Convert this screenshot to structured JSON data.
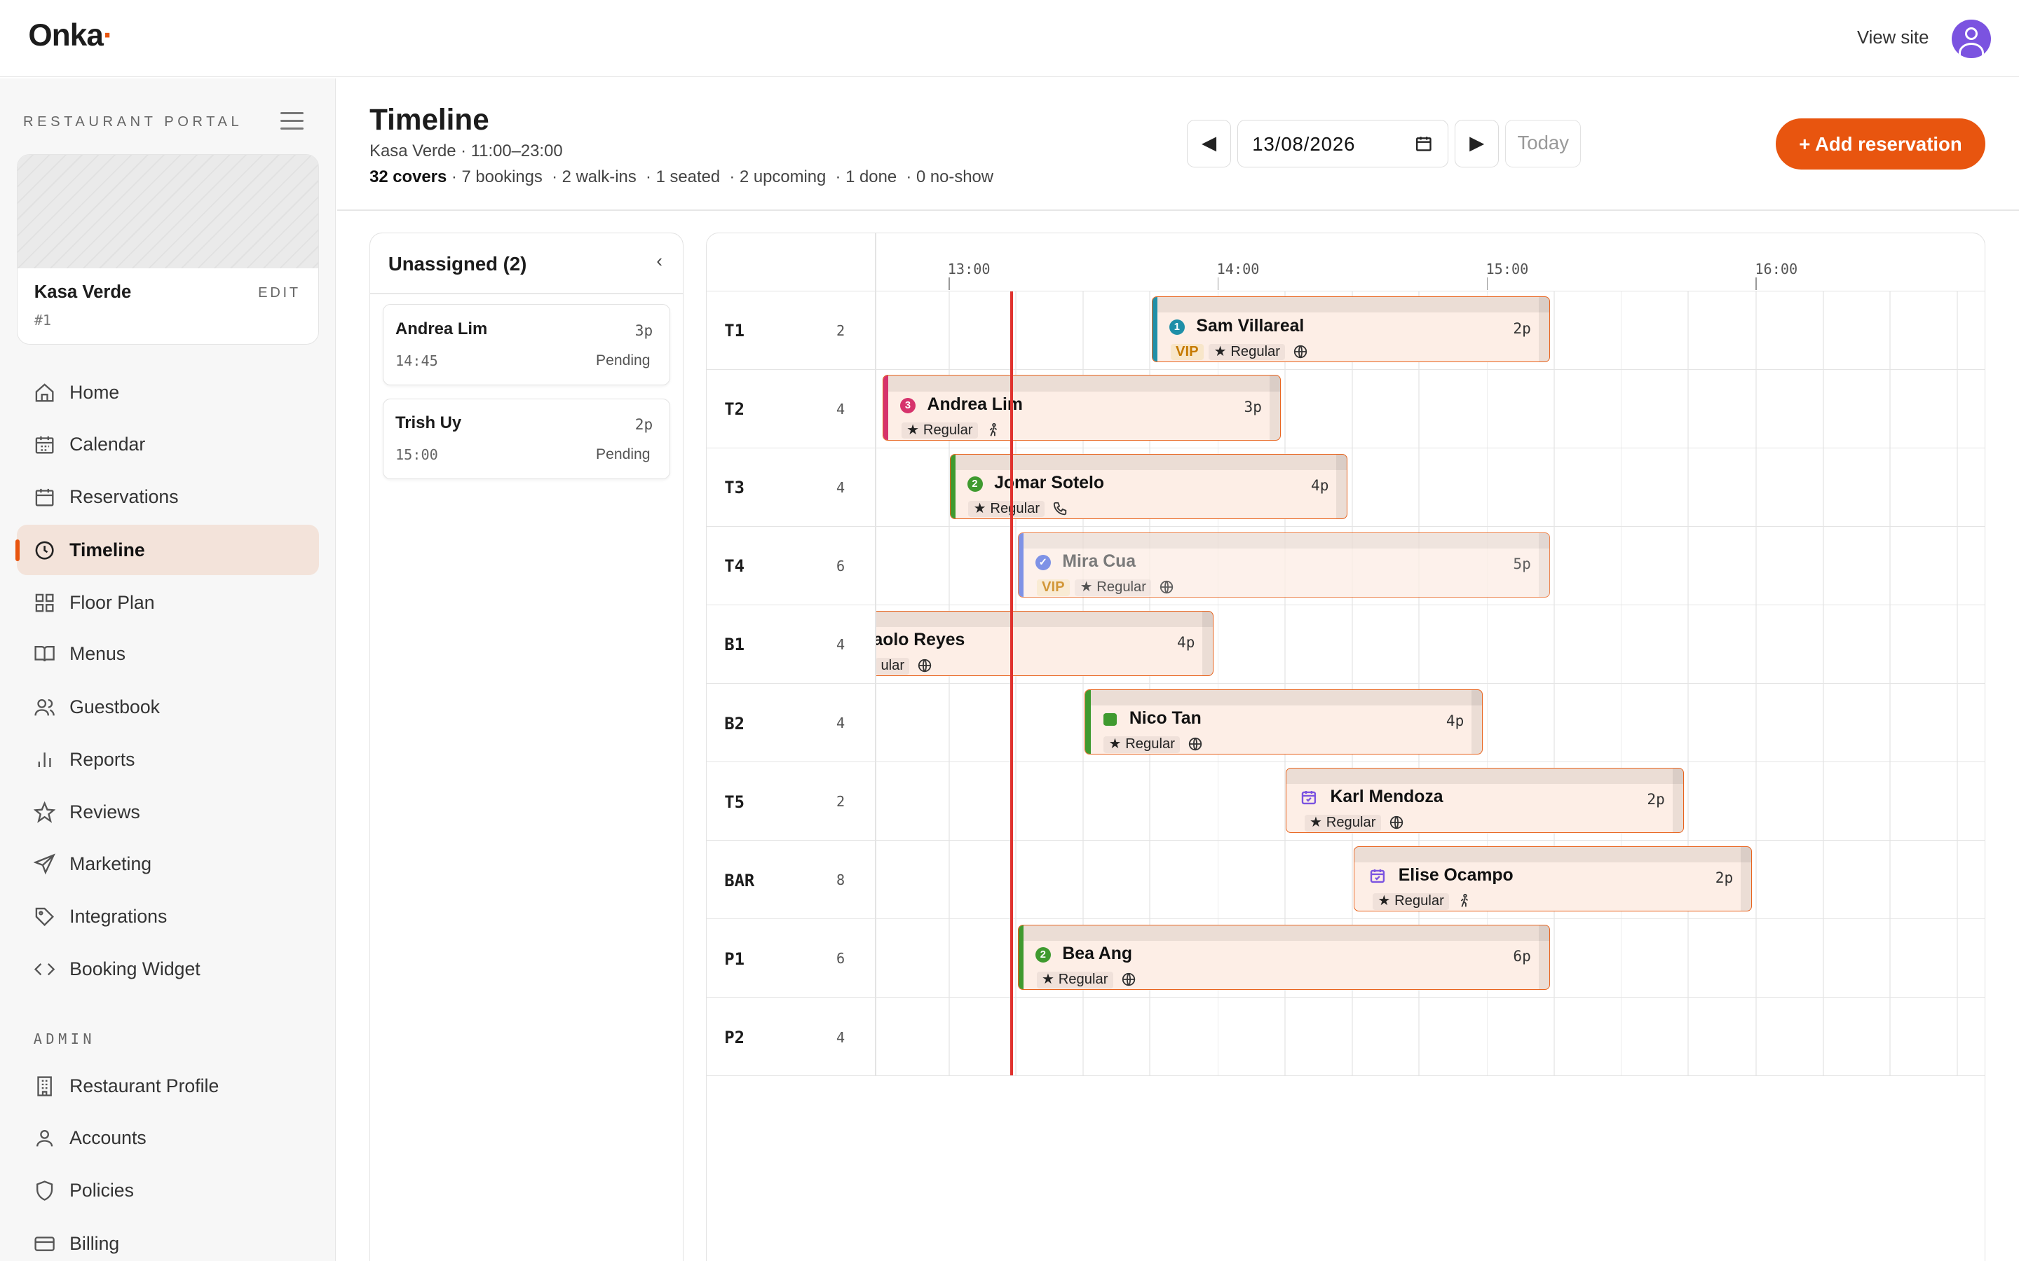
{
  "brand": {
    "name": "Onka",
    "dot": "·",
    "accent": "#e8550f"
  },
  "topbar": {
    "view_site": "View site",
    "avatar_icon": "user-avatar-icon"
  },
  "sidebar": {
    "portal_label": "RESTAURANT PORTAL",
    "restaurant": {
      "name": "Kasa Verde",
      "edit": "EDIT",
      "id": "#1"
    },
    "items": [
      {
        "label": "Home",
        "icon": "home-icon"
      },
      {
        "label": "Calendar",
        "icon": "calendar-grid-icon"
      },
      {
        "label": "Reservations",
        "icon": "calendar-icon"
      },
      {
        "label": "Timeline",
        "icon": "clock-icon",
        "active": true
      },
      {
        "label": "Floor Plan",
        "icon": "grid-icon"
      },
      {
        "label": "Menus",
        "icon": "book-icon"
      },
      {
        "label": "Guestbook",
        "icon": "users-icon"
      },
      {
        "label": "Reports",
        "icon": "bar-chart-icon"
      },
      {
        "label": "Reviews",
        "icon": "star-icon"
      },
      {
        "label": "Marketing",
        "icon": "send-icon"
      },
      {
        "label": "Integrations",
        "icon": "tag-icon"
      },
      {
        "label": "Booking Widget",
        "icon": "code-icon"
      }
    ],
    "admin_label": "ADMIN",
    "admin_items": [
      {
        "label": "Restaurant Profile",
        "icon": "building-icon"
      },
      {
        "label": "Accounts",
        "icon": "user-icon"
      },
      {
        "label": "Policies",
        "icon": "shield-icon"
      },
      {
        "label": "Billing",
        "icon": "credit-card-icon"
      }
    ]
  },
  "header": {
    "title": "Timeline",
    "subtitle": "Kasa Verde · 11:00–23:00",
    "covers": "32 covers",
    "stats": " · 7 bookings  · 2 walk-ins  · 1 seated  · 2 upcoming  · 1 done  · 0 no-show",
    "prev": "◀",
    "next": "▶",
    "date": "13/08/2026",
    "today": "Today",
    "add_reservation": "+ Add reservation"
  },
  "unassigned": {
    "title": "Unassigned (2)",
    "collapse": "‹",
    "items": [
      {
        "name": "Andrea Lim",
        "party": "3p",
        "time": "14:45",
        "status": "Pending"
      },
      {
        "name": "Trish Uy",
        "party": "2p",
        "time": "15:00",
        "status": "Pending"
      }
    ]
  },
  "timeline": {
    "hours": [
      "13:00",
      "14:00",
      "15:00",
      "16:00"
    ],
    "tables": [
      {
        "name": "T1",
        "seats": "2"
      },
      {
        "name": "T2",
        "seats": "4"
      },
      {
        "name": "T3",
        "seats": "4"
      },
      {
        "name": "T4",
        "seats": "6"
      },
      {
        "name": "B1",
        "seats": "4"
      },
      {
        "name": "B2",
        "seats": "4"
      },
      {
        "name": "T5",
        "seats": "2"
      },
      {
        "name": "BAR",
        "seats": "8"
      },
      {
        "name": "P1",
        "seats": "6"
      },
      {
        "name": "P2",
        "seats": "4"
      }
    ],
    "bookings": [
      {
        "name": "Sam Villareal",
        "party": "2p",
        "vip": "VIP",
        "tag": "★ Regular",
        "channel": "globe-icon",
        "status_icon": "1",
        "accent": "#1f8fa8"
      },
      {
        "name": "Andrea Lim",
        "party": "3p",
        "tag": "★ Regular",
        "channel": "walk-in-icon",
        "status_icon": "3",
        "accent": "#d6336c"
      },
      {
        "name": "Jomar Sotelo",
        "party": "4p",
        "tag": "★ Regular",
        "channel": "phone-icon",
        "status_icon": "2",
        "accent": "#3f9a2f"
      },
      {
        "name": "Mira Cua",
        "party": "5p",
        "vip": "VIP",
        "tag": "★ Regular",
        "channel": "globe-icon",
        "status_icon": "✓",
        "accent": "#5b74e0"
      },
      {
        "name": "aolo Reyes",
        "party": "4p",
        "tag": "ular",
        "channel": "globe-icon"
      },
      {
        "name": "Nico Tan",
        "party": "4p",
        "tag": "★ Regular",
        "channel": "globe-icon",
        "accent": "#3f9a2f"
      },
      {
        "name": "Karl Mendoza",
        "party": "2p",
        "tag": "★ Regular",
        "channel": "globe-icon"
      },
      {
        "name": "Elise Ocampo",
        "party": "2p",
        "tag": "★ Regular",
        "channel": "walk-in-icon"
      },
      {
        "name": "Bea Ang",
        "party": "6p",
        "tag": "★ Regular",
        "channel": "globe-icon",
        "status_icon": "2",
        "accent": "#3f9a2f"
      }
    ],
    "now_marker_color": "#e0322e"
  }
}
